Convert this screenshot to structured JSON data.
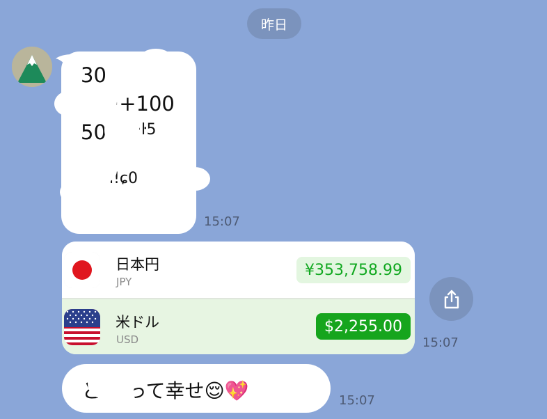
{
  "date_separator": "昨日",
  "messages": [
    {
      "fragments": [
        "30",
        "·+100",
        "50",
        "·ŀ5",
        "·ı!ɕ0"
      ],
      "time": "15:07",
      "avatar_icon": "mountain-avatar-icon"
    },
    {
      "currency_rows": [
        {
          "name": "日本円",
          "code": "JPY",
          "amount": "¥353,758.99",
          "flag_icon": "japan-flag-icon"
        },
        {
          "name": "米ドル",
          "code": "USD",
          "amount": "$2,255.00",
          "flag_icon": "us-flag-icon"
        }
      ],
      "time": "15:07",
      "share_icon": "share-icon"
    },
    {
      "text": "ど     いって幸せ😌💖",
      "time": "15:07"
    }
  ],
  "colors": {
    "background": "#8aa6d8",
    "bubble": "#ffffff",
    "accent_green": "#16a51d",
    "pill": "#7b93bd"
  }
}
